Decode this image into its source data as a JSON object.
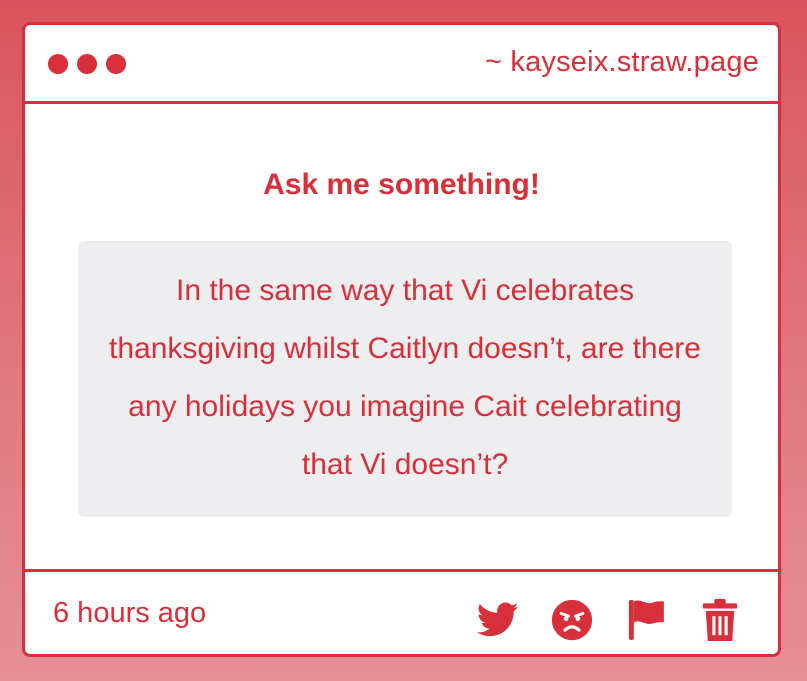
{
  "window": {
    "url": "~ kayseix.straw.page"
  },
  "main": {
    "heading": "Ask me something!",
    "question": "In the same way that Vi celebrates thanksgiving whilst Caitlyn doesn’t, are there any holidays you imagine Cait celebrating that Vi doesn’t?"
  },
  "footer": {
    "timestamp": "6 hours ago",
    "actions": [
      {
        "icon": "twitter-icon"
      },
      {
        "icon": "angry-face-icon"
      },
      {
        "icon": "flag-icon"
      },
      {
        "icon": "trash-icon"
      }
    ]
  },
  "colors": {
    "accent": "#d8303a",
    "question_bg": "#eeedef",
    "card_bg": "#ffffff"
  }
}
